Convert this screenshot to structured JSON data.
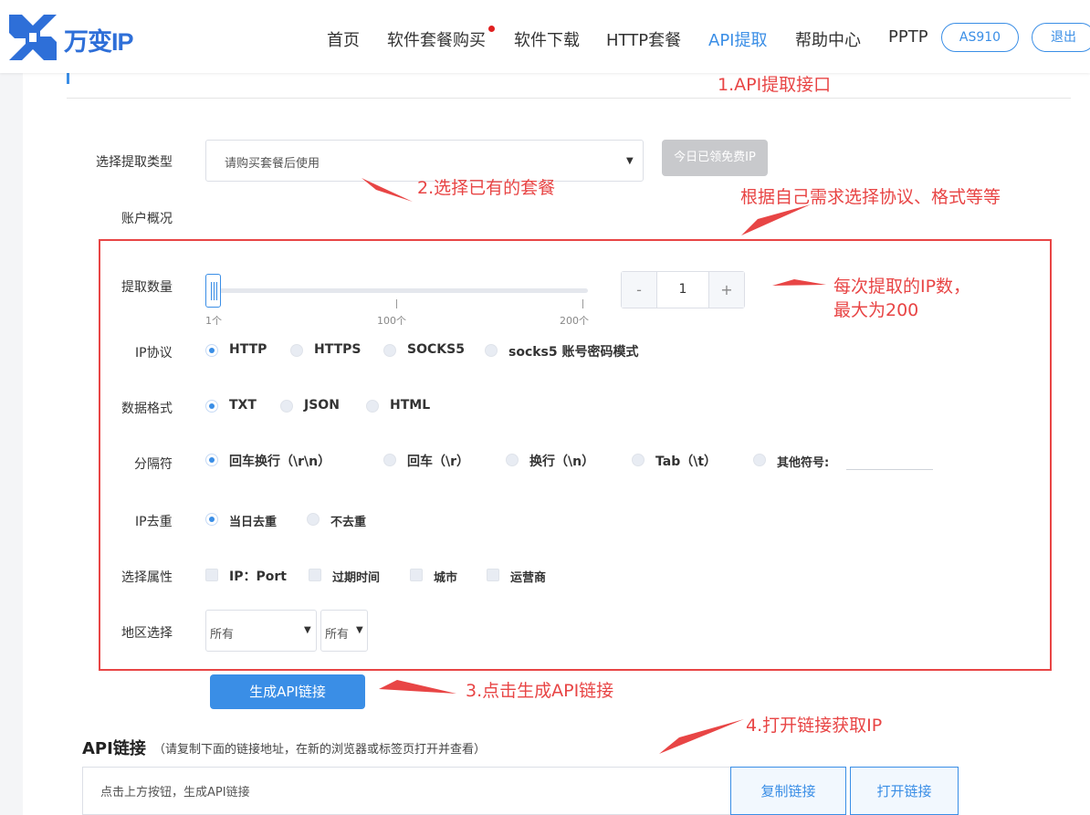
{
  "header": {
    "logo_text": "万变IP",
    "nav": [
      "首页",
      "软件套餐购买",
      "软件下载",
      "HTTP套餐",
      "API提取",
      "帮助中心",
      "PPTP"
    ],
    "user_label": "AS910",
    "logout_label": "退出"
  },
  "form": {
    "type_label": "选择提取类型",
    "type_placeholder": "请购买套餐后使用",
    "free_ip_button": "今日已领免费IP",
    "account_label": "账户概况",
    "quantity_label": "提取数量",
    "slider_ticks": [
      "1个",
      "100个",
      "200个"
    ],
    "quantity_value": "1",
    "quantity_minus": "-",
    "quantity_plus": "+",
    "protocol_label": "IP协议",
    "protocols": [
      "HTTP",
      "HTTPS",
      "SOCKS5",
      "socks5 账号密码模式"
    ],
    "format_label": "数据格式",
    "formats": [
      "TXT",
      "JSON",
      "HTML"
    ],
    "separator_label": "分隔符",
    "separators": [
      "回车换行（\\r\\n）",
      "回车（\\r）",
      "换行（\\n）",
      "Tab（\\t）",
      "其他符号:"
    ],
    "dedup_label": "IP去重",
    "dedups": [
      "当日去重",
      "不去重"
    ],
    "attr_label": "选择属性",
    "attrs": [
      "IP：Port",
      "过期时间",
      "城市",
      "运营商"
    ],
    "region_label": "地区选择",
    "region_1": "所有",
    "region_2": "所有",
    "generate_button": "生成API链接"
  },
  "api": {
    "title": "API链接",
    "hint": "（请复制下面的链接地址，在新的浏览器或标签页打开并查看）",
    "placeholder": "点击上方按钮，生成API链接",
    "copy_button": "复制链接",
    "open_button": "打开链接"
  },
  "annotations": {
    "n1": "1.API提取接口",
    "n2": "2.选择已有的套餐",
    "n_proto": "根据自己需求选择协议、格式等等",
    "n_ip_line1": "每次提取的IP数，",
    "n_ip_line2": "最大为200",
    "n3": "3.点击生成API链接",
    "n4": "4.打开链接获取IP"
  },
  "colors": {
    "accent": "#3a8ee6",
    "annotation": "#e84545"
  }
}
